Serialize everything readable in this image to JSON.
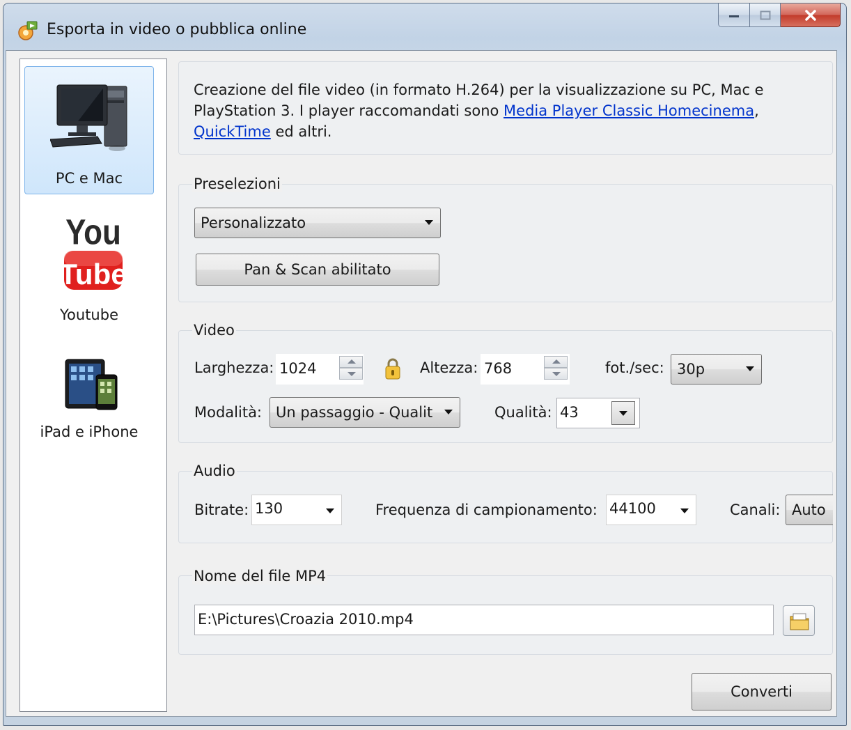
{
  "window": {
    "title": "Esporta in video o pubblica online"
  },
  "sidebar": {
    "items": [
      {
        "label": "PC e Mac",
        "selected": true,
        "icon": "desktop-pc-icon"
      },
      {
        "label": "Youtube",
        "selected": false,
        "icon": "youtube-logo-icon",
        "logo_text": [
          "You",
          "Tube"
        ]
      },
      {
        "label": "iPad e iPhone",
        "selected": false,
        "icon": "ipad-iphone-icon"
      }
    ]
  },
  "description": {
    "text_before": "Creazione del file video (in formato H.264) per la visualizzazione su PC, Mac e PlayStation 3. I player raccomandati sono ",
    "link1": "Media Player Classic Homecinema",
    "text_between": ", ",
    "link2": "QuickTime",
    "text_after": " ed altri."
  },
  "presets": {
    "group_title": "Preselezioni",
    "selected": "Personalizzato",
    "pan_scan_button": "Pan & Scan abilitato"
  },
  "video": {
    "group_title": "Video",
    "width_label": "Larghezza:",
    "width_value": "1024",
    "height_label": "Altezza:",
    "height_value": "768",
    "fps_label": "fot./sec:",
    "fps_value": "30p",
    "mode_label": "Modalità:",
    "mode_value": "Un passaggio - Qualit",
    "quality_label": "Qualità:",
    "quality_value": "43"
  },
  "audio": {
    "group_title": "Audio",
    "bitrate_label": "Bitrate:",
    "bitrate_value": "130",
    "freq_label": "Frequenza di campionamento:",
    "freq_value": "44100",
    "channels_label": "Canali:",
    "channels_value": "Auto"
  },
  "output": {
    "group_title": "Nome del file MP4",
    "path": "E:\\Pictures\\Croazia 2010.mp4"
  },
  "convert_button": "Converti"
}
